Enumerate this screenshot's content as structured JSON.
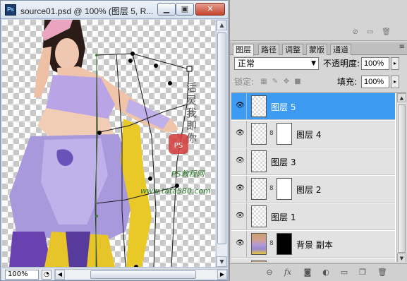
{
  "document": {
    "title": "source01.psd @ 100% (图层 5, R...",
    "app_icon": "Ps",
    "zoom": "100%",
    "window_buttons": [
      "minimize",
      "maximize",
      "close"
    ],
    "watermark": {
      "vertical_text": "活灵我即你",
      "seal_text": "PS",
      "site_name": "PS教程网",
      "site_url": "www.tata580.com"
    }
  },
  "panel": {
    "tabs": [
      "图层",
      "路径",
      "调整",
      "蒙版",
      "通道"
    ],
    "active_tab": "图层",
    "blend_mode": "正常",
    "opacity_label": "不透明度:",
    "opacity_value": "100%",
    "lock_label": "锁定:",
    "fill_label": "填充:",
    "fill_value": "100%",
    "layers": [
      {
        "name": "图层 5",
        "selected": true,
        "thumb": "transparent",
        "mask": null
      },
      {
        "name": "图层 4",
        "selected": false,
        "thumb": "transparent",
        "mask": "white"
      },
      {
        "name": "图层 3",
        "selected": false,
        "thumb": "transparent",
        "mask": null
      },
      {
        "name": "图层 2",
        "selected": false,
        "thumb": "transparent",
        "mask": "white"
      },
      {
        "name": "图层 1",
        "selected": false,
        "thumb": "transparent",
        "mask": null
      },
      {
        "name": "背景 副本",
        "selected": false,
        "thumb": "photo",
        "mask": "black"
      }
    ],
    "bottom_icons": [
      "link-icon",
      "fx-icon",
      "add-mask-icon",
      "adjustment-icon",
      "group-folder-icon",
      "new-layer-icon",
      "delete-icon"
    ],
    "top_icons": [
      "no-entry-icon",
      "new-icon",
      "trash-icon"
    ]
  },
  "colors": {
    "selection": "#3d9bf2",
    "titlebar": "#dde6f1"
  }
}
